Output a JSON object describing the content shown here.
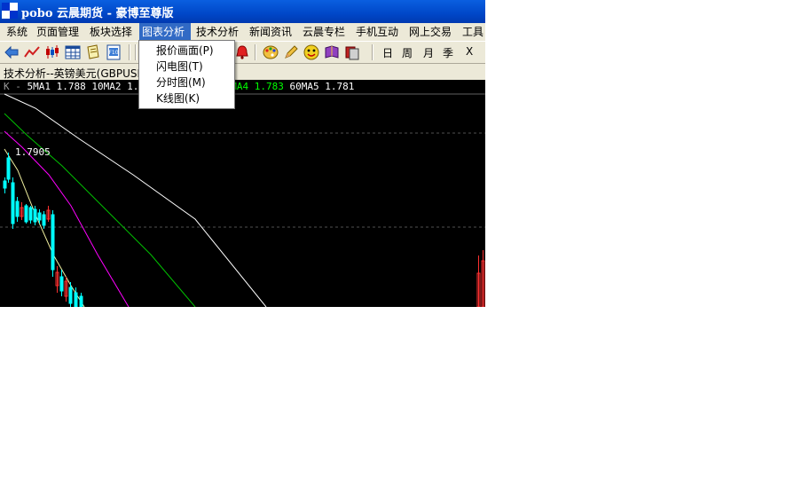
{
  "window": {
    "title": "pobo 云晨期货 - 豪博至尊版"
  },
  "menu": {
    "items": [
      {
        "label": "系统"
      },
      {
        "label": "页面管理"
      },
      {
        "label": "板块选择"
      },
      {
        "label": "图表分析",
        "active": true
      },
      {
        "label": "技术分析"
      },
      {
        "label": "新闻资讯"
      },
      {
        "label": "云晨专栏"
      },
      {
        "label": "手机互动"
      },
      {
        "label": "网上交易"
      },
      {
        "label": "工具"
      }
    ]
  },
  "dropdown": {
    "items": [
      {
        "label": "报价画面(P)"
      },
      {
        "label": "闪电图(T)"
      },
      {
        "label": "分时图(M)"
      },
      {
        "label": "K线图(K)"
      }
    ]
  },
  "toolbar": {
    "icons": [
      "back-arrow-icon",
      "line-chart-icon",
      "candlestick-icon",
      "grid-table-icon",
      "notepad-icon",
      "document-icon",
      "alarm-bell-icon",
      "palette-icon",
      "pencil-icon",
      "face-icon",
      "book-icon",
      "stack-icon"
    ],
    "periods": {
      "day": "日",
      "week": "周",
      "month": "月",
      "season": "季",
      "close": "X"
    }
  },
  "chart": {
    "title": "技术分析--英镑美元(GBPUSD",
    "ma_prefix": "K - ",
    "ma_items": [
      {
        "label": "5MA1",
        "value": "1.788",
        "color": "#ffffff"
      },
      {
        "label": "10MA2",
        "value": "1.7",
        "color": "#ffffff"
      },
      {
        "label": "MA4",
        "value": "1.783",
        "color": "#00ff00"
      },
      {
        "label": "60MA5",
        "value": "1.781",
        "color": "#ffffff"
      }
    ],
    "high_label": "1.7905",
    "colors": {
      "background": "#000000",
      "ma_white": "#ffffff",
      "ma_yellow": "#f0f0a0",
      "ma_magenta": "#ff00ff",
      "ma_green": "#00c000",
      "candle_up": "#ff3030",
      "candle_down": "#00ffff"
    }
  }
}
